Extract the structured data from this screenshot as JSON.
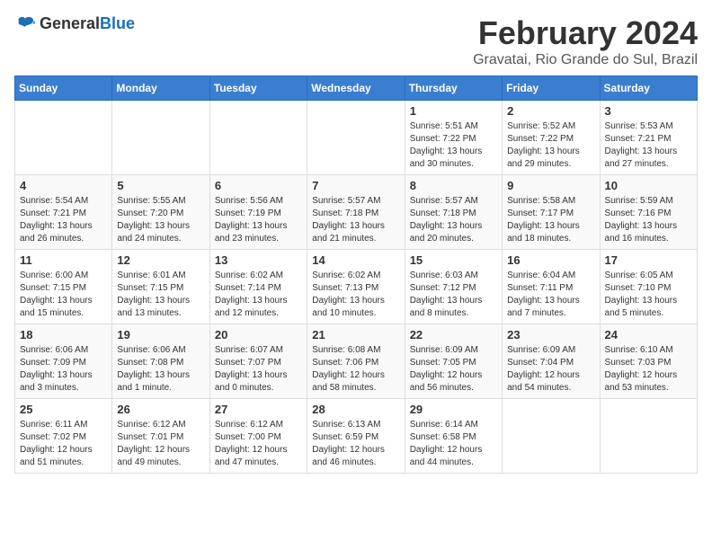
{
  "header": {
    "logo_general": "General",
    "logo_blue": "Blue",
    "month_year": "February 2024",
    "location": "Gravatai, Rio Grande do Sul, Brazil"
  },
  "weekdays": [
    "Sunday",
    "Monday",
    "Tuesday",
    "Wednesday",
    "Thursday",
    "Friday",
    "Saturday"
  ],
  "weeks": [
    [
      {
        "day": "",
        "info": ""
      },
      {
        "day": "",
        "info": ""
      },
      {
        "day": "",
        "info": ""
      },
      {
        "day": "",
        "info": ""
      },
      {
        "day": "1",
        "info": "Sunrise: 5:51 AM\nSunset: 7:22 PM\nDaylight: 13 hours and 30 minutes."
      },
      {
        "day": "2",
        "info": "Sunrise: 5:52 AM\nSunset: 7:22 PM\nDaylight: 13 hours and 29 minutes."
      },
      {
        "day": "3",
        "info": "Sunrise: 5:53 AM\nSunset: 7:21 PM\nDaylight: 13 hours and 27 minutes."
      }
    ],
    [
      {
        "day": "4",
        "info": "Sunrise: 5:54 AM\nSunset: 7:21 PM\nDaylight: 13 hours and 26 minutes."
      },
      {
        "day": "5",
        "info": "Sunrise: 5:55 AM\nSunset: 7:20 PM\nDaylight: 13 hours and 24 minutes."
      },
      {
        "day": "6",
        "info": "Sunrise: 5:56 AM\nSunset: 7:19 PM\nDaylight: 13 hours and 23 minutes."
      },
      {
        "day": "7",
        "info": "Sunrise: 5:57 AM\nSunset: 7:18 PM\nDaylight: 13 hours and 21 minutes."
      },
      {
        "day": "8",
        "info": "Sunrise: 5:57 AM\nSunset: 7:18 PM\nDaylight: 13 hours and 20 minutes."
      },
      {
        "day": "9",
        "info": "Sunrise: 5:58 AM\nSunset: 7:17 PM\nDaylight: 13 hours and 18 minutes."
      },
      {
        "day": "10",
        "info": "Sunrise: 5:59 AM\nSunset: 7:16 PM\nDaylight: 13 hours and 16 minutes."
      }
    ],
    [
      {
        "day": "11",
        "info": "Sunrise: 6:00 AM\nSunset: 7:15 PM\nDaylight: 13 hours and 15 minutes."
      },
      {
        "day": "12",
        "info": "Sunrise: 6:01 AM\nSunset: 7:15 PM\nDaylight: 13 hours and 13 minutes."
      },
      {
        "day": "13",
        "info": "Sunrise: 6:02 AM\nSunset: 7:14 PM\nDaylight: 13 hours and 12 minutes."
      },
      {
        "day": "14",
        "info": "Sunrise: 6:02 AM\nSunset: 7:13 PM\nDaylight: 13 hours and 10 minutes."
      },
      {
        "day": "15",
        "info": "Sunrise: 6:03 AM\nSunset: 7:12 PM\nDaylight: 13 hours and 8 minutes."
      },
      {
        "day": "16",
        "info": "Sunrise: 6:04 AM\nSunset: 7:11 PM\nDaylight: 13 hours and 7 minutes."
      },
      {
        "day": "17",
        "info": "Sunrise: 6:05 AM\nSunset: 7:10 PM\nDaylight: 13 hours and 5 minutes."
      }
    ],
    [
      {
        "day": "18",
        "info": "Sunrise: 6:06 AM\nSunset: 7:09 PM\nDaylight: 13 hours and 3 minutes."
      },
      {
        "day": "19",
        "info": "Sunrise: 6:06 AM\nSunset: 7:08 PM\nDaylight: 13 hours and 1 minute."
      },
      {
        "day": "20",
        "info": "Sunrise: 6:07 AM\nSunset: 7:07 PM\nDaylight: 13 hours and 0 minutes."
      },
      {
        "day": "21",
        "info": "Sunrise: 6:08 AM\nSunset: 7:06 PM\nDaylight: 12 hours and 58 minutes."
      },
      {
        "day": "22",
        "info": "Sunrise: 6:09 AM\nSunset: 7:05 PM\nDaylight: 12 hours and 56 minutes."
      },
      {
        "day": "23",
        "info": "Sunrise: 6:09 AM\nSunset: 7:04 PM\nDaylight: 12 hours and 54 minutes."
      },
      {
        "day": "24",
        "info": "Sunrise: 6:10 AM\nSunset: 7:03 PM\nDaylight: 12 hours and 53 minutes."
      }
    ],
    [
      {
        "day": "25",
        "info": "Sunrise: 6:11 AM\nSunset: 7:02 PM\nDaylight: 12 hours and 51 minutes."
      },
      {
        "day": "26",
        "info": "Sunrise: 6:12 AM\nSunset: 7:01 PM\nDaylight: 12 hours and 49 minutes."
      },
      {
        "day": "27",
        "info": "Sunrise: 6:12 AM\nSunset: 7:00 PM\nDaylight: 12 hours and 47 minutes."
      },
      {
        "day": "28",
        "info": "Sunrise: 6:13 AM\nSunset: 6:59 PM\nDaylight: 12 hours and 46 minutes."
      },
      {
        "day": "29",
        "info": "Sunrise: 6:14 AM\nSunset: 6:58 PM\nDaylight: 12 hours and 44 minutes."
      },
      {
        "day": "",
        "info": ""
      },
      {
        "day": "",
        "info": ""
      }
    ]
  ]
}
